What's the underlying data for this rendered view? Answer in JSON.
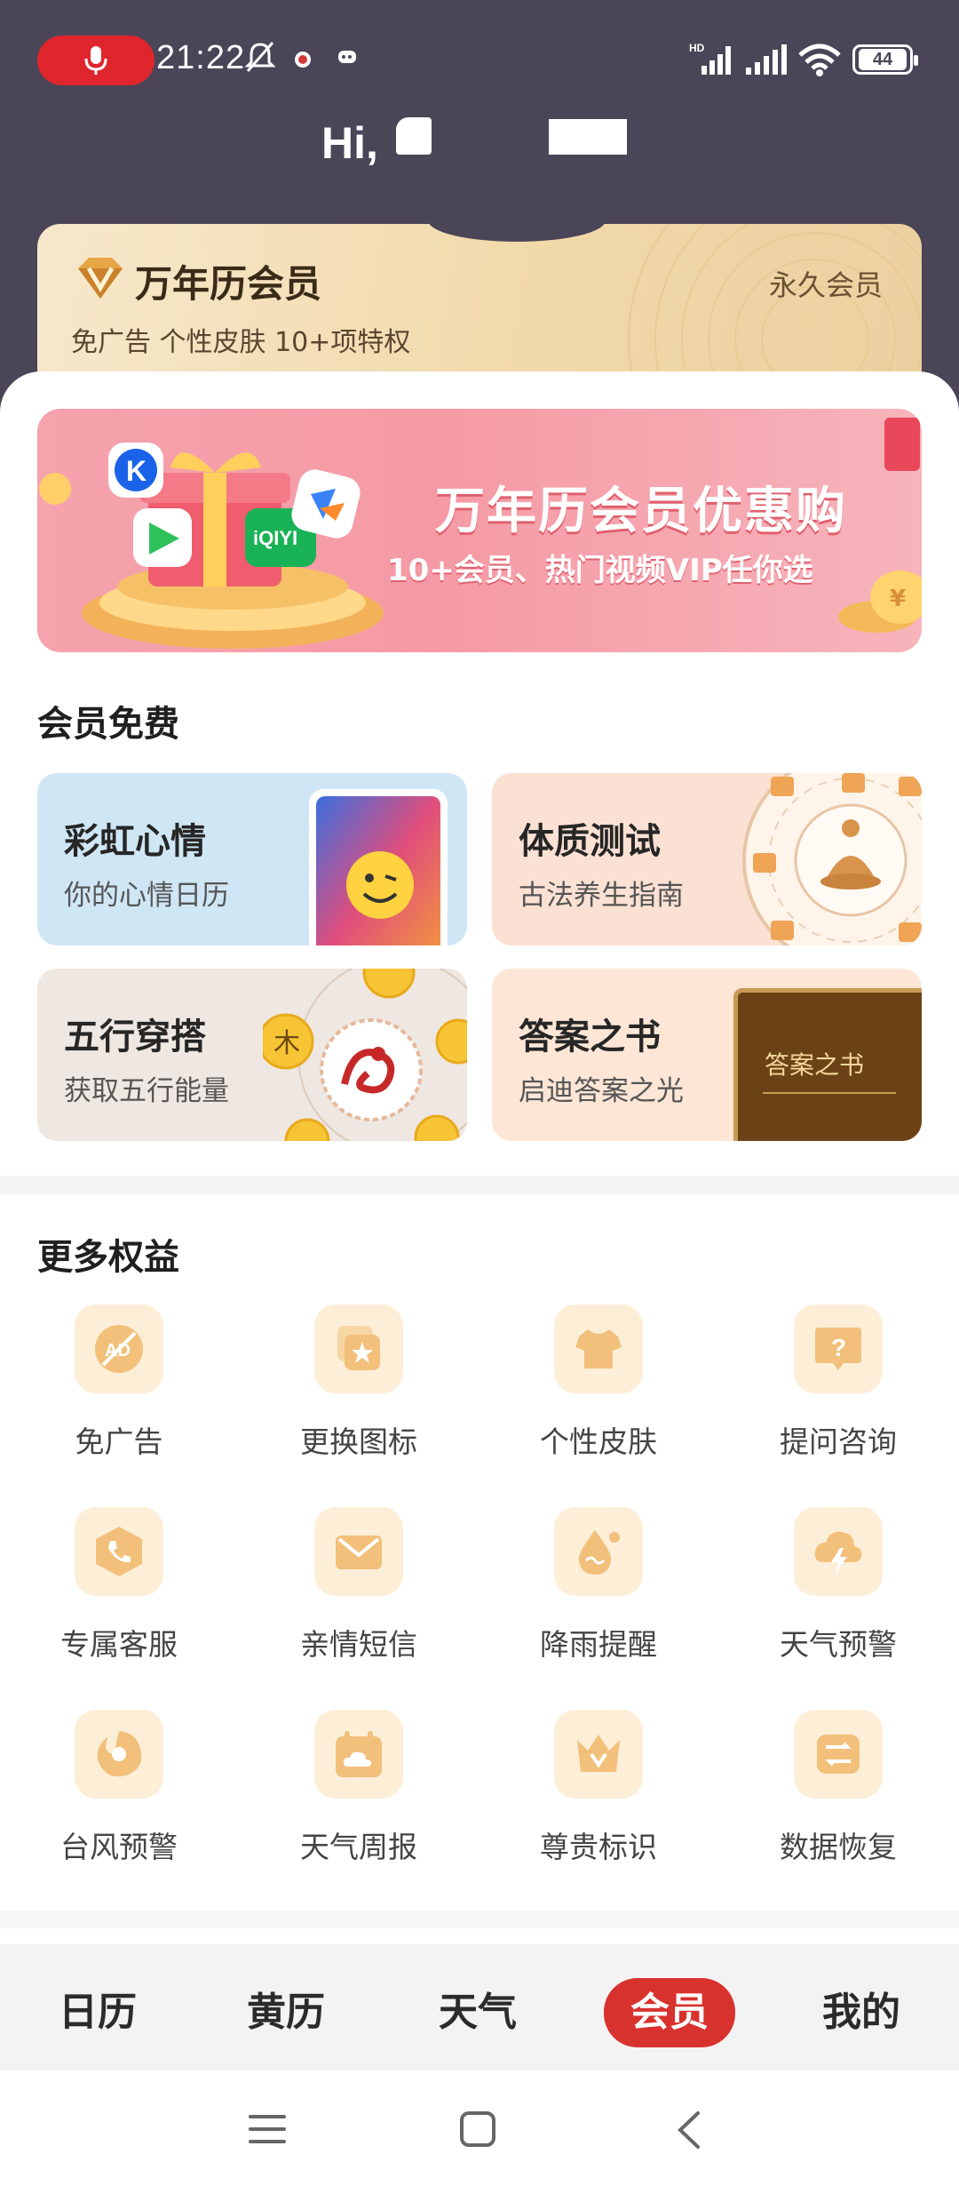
{
  "status_bar": {
    "time": "21:22",
    "battery": "44"
  },
  "header": {
    "greeting": "Hi,"
  },
  "vip_card": {
    "title": "万年历会员",
    "status": "永久会员",
    "description": "免广告 个性皮肤 10+项特权"
  },
  "banner": {
    "title": "万年历会员优惠购",
    "subtitle": "10+会员、热门视频VIP任你选",
    "iqiyi": "iQIYI"
  },
  "free_section": {
    "title": "会员免费",
    "cards": [
      {
        "title": "彩虹心情",
        "subtitle": "你的心情日历"
      },
      {
        "title": "体质测试",
        "subtitle": "古法养生指南"
      },
      {
        "title": "五行穿搭",
        "subtitle": "获取五行能量"
      },
      {
        "title": "答案之书",
        "subtitle": "启迪答案之光",
        "book_title": "答案之书"
      }
    ]
  },
  "more_section": {
    "title": "更多权益",
    "items": [
      {
        "label": "免广告",
        "icon": "no-ads-icon"
      },
      {
        "label": "更换图标",
        "icon": "change-icon-icon"
      },
      {
        "label": "个性皮肤",
        "icon": "tshirt-icon"
      },
      {
        "label": "提问咨询",
        "icon": "question-icon"
      },
      {
        "label": "专属客服",
        "icon": "phone-icon"
      },
      {
        "label": "亲情短信",
        "icon": "envelope-icon"
      },
      {
        "label": "降雨提醒",
        "icon": "raindrop-icon"
      },
      {
        "label": "天气预警",
        "icon": "storm-cloud-icon"
      },
      {
        "label": "台风预警",
        "icon": "typhoon-icon"
      },
      {
        "label": "天气周报",
        "icon": "weather-report-icon"
      },
      {
        "label": "尊贵标识",
        "icon": "crown-icon"
      },
      {
        "label": "数据恢复",
        "icon": "data-restore-icon"
      }
    ]
  },
  "tabbar": {
    "tabs": [
      "日历",
      "黄历",
      "天气",
      "会员",
      "我的"
    ],
    "active": "会员"
  },
  "colors": {
    "header_bg": "#4a4557",
    "accent_red": "#d8322e",
    "gold_icon": "#f2c07a"
  }
}
